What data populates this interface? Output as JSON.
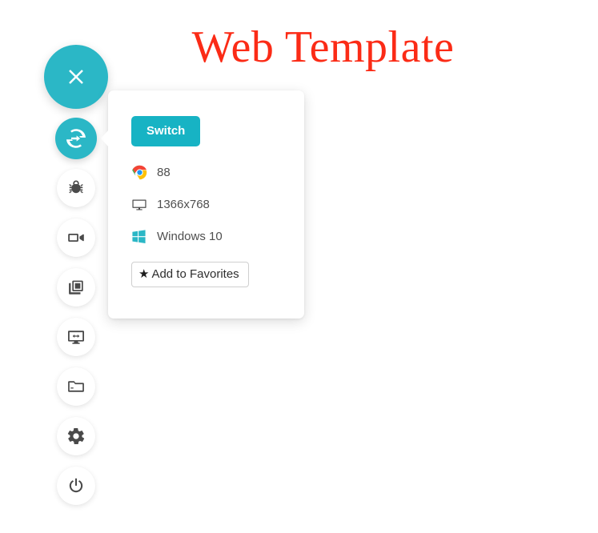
{
  "header": {
    "title": "Web Template",
    "title_color": "#fb2b16"
  },
  "theme": {
    "accent": "#2bb7c6",
    "button_accent": "#17b3c4",
    "icon_dark": "#4a4a4a",
    "text": "#4f4f4f",
    "background": "#ffffff"
  },
  "sidebar": {
    "items": [
      {
        "name": "close-button",
        "icon": "close-x-icon",
        "label": "Close",
        "state": "accent"
      },
      {
        "name": "switch-button",
        "icon": "switch-arrows-icon",
        "label": "Switch",
        "state": "active"
      },
      {
        "name": "bug-button",
        "icon": "bug-icon",
        "label": "Report Bug",
        "state": "default"
      },
      {
        "name": "record-button",
        "icon": "video-camera-icon",
        "label": "Record",
        "state": "default"
      },
      {
        "name": "screenshot-button",
        "icon": "copy-layers-icon",
        "label": "Screenshots",
        "state": "default"
      },
      {
        "name": "resolution-button",
        "icon": "monitor-resize-icon",
        "label": "Resolution",
        "state": "default"
      },
      {
        "name": "files-button",
        "icon": "folder-icon",
        "label": "Files",
        "state": "default"
      },
      {
        "name": "settings-button",
        "icon": "gear-icon",
        "label": "Settings",
        "state": "default"
      },
      {
        "name": "power-button",
        "icon": "power-icon",
        "label": "Power",
        "state": "default"
      }
    ]
  },
  "popup": {
    "switch_label": "Switch",
    "info": [
      {
        "icon": "chrome-icon",
        "value": "88"
      },
      {
        "icon": "monitor-icon",
        "value": "1366x768"
      },
      {
        "icon": "windows-icon",
        "value": "Windows 10"
      }
    ],
    "favorites": {
      "icon": "star-icon",
      "label": "Add to Favorites"
    }
  }
}
